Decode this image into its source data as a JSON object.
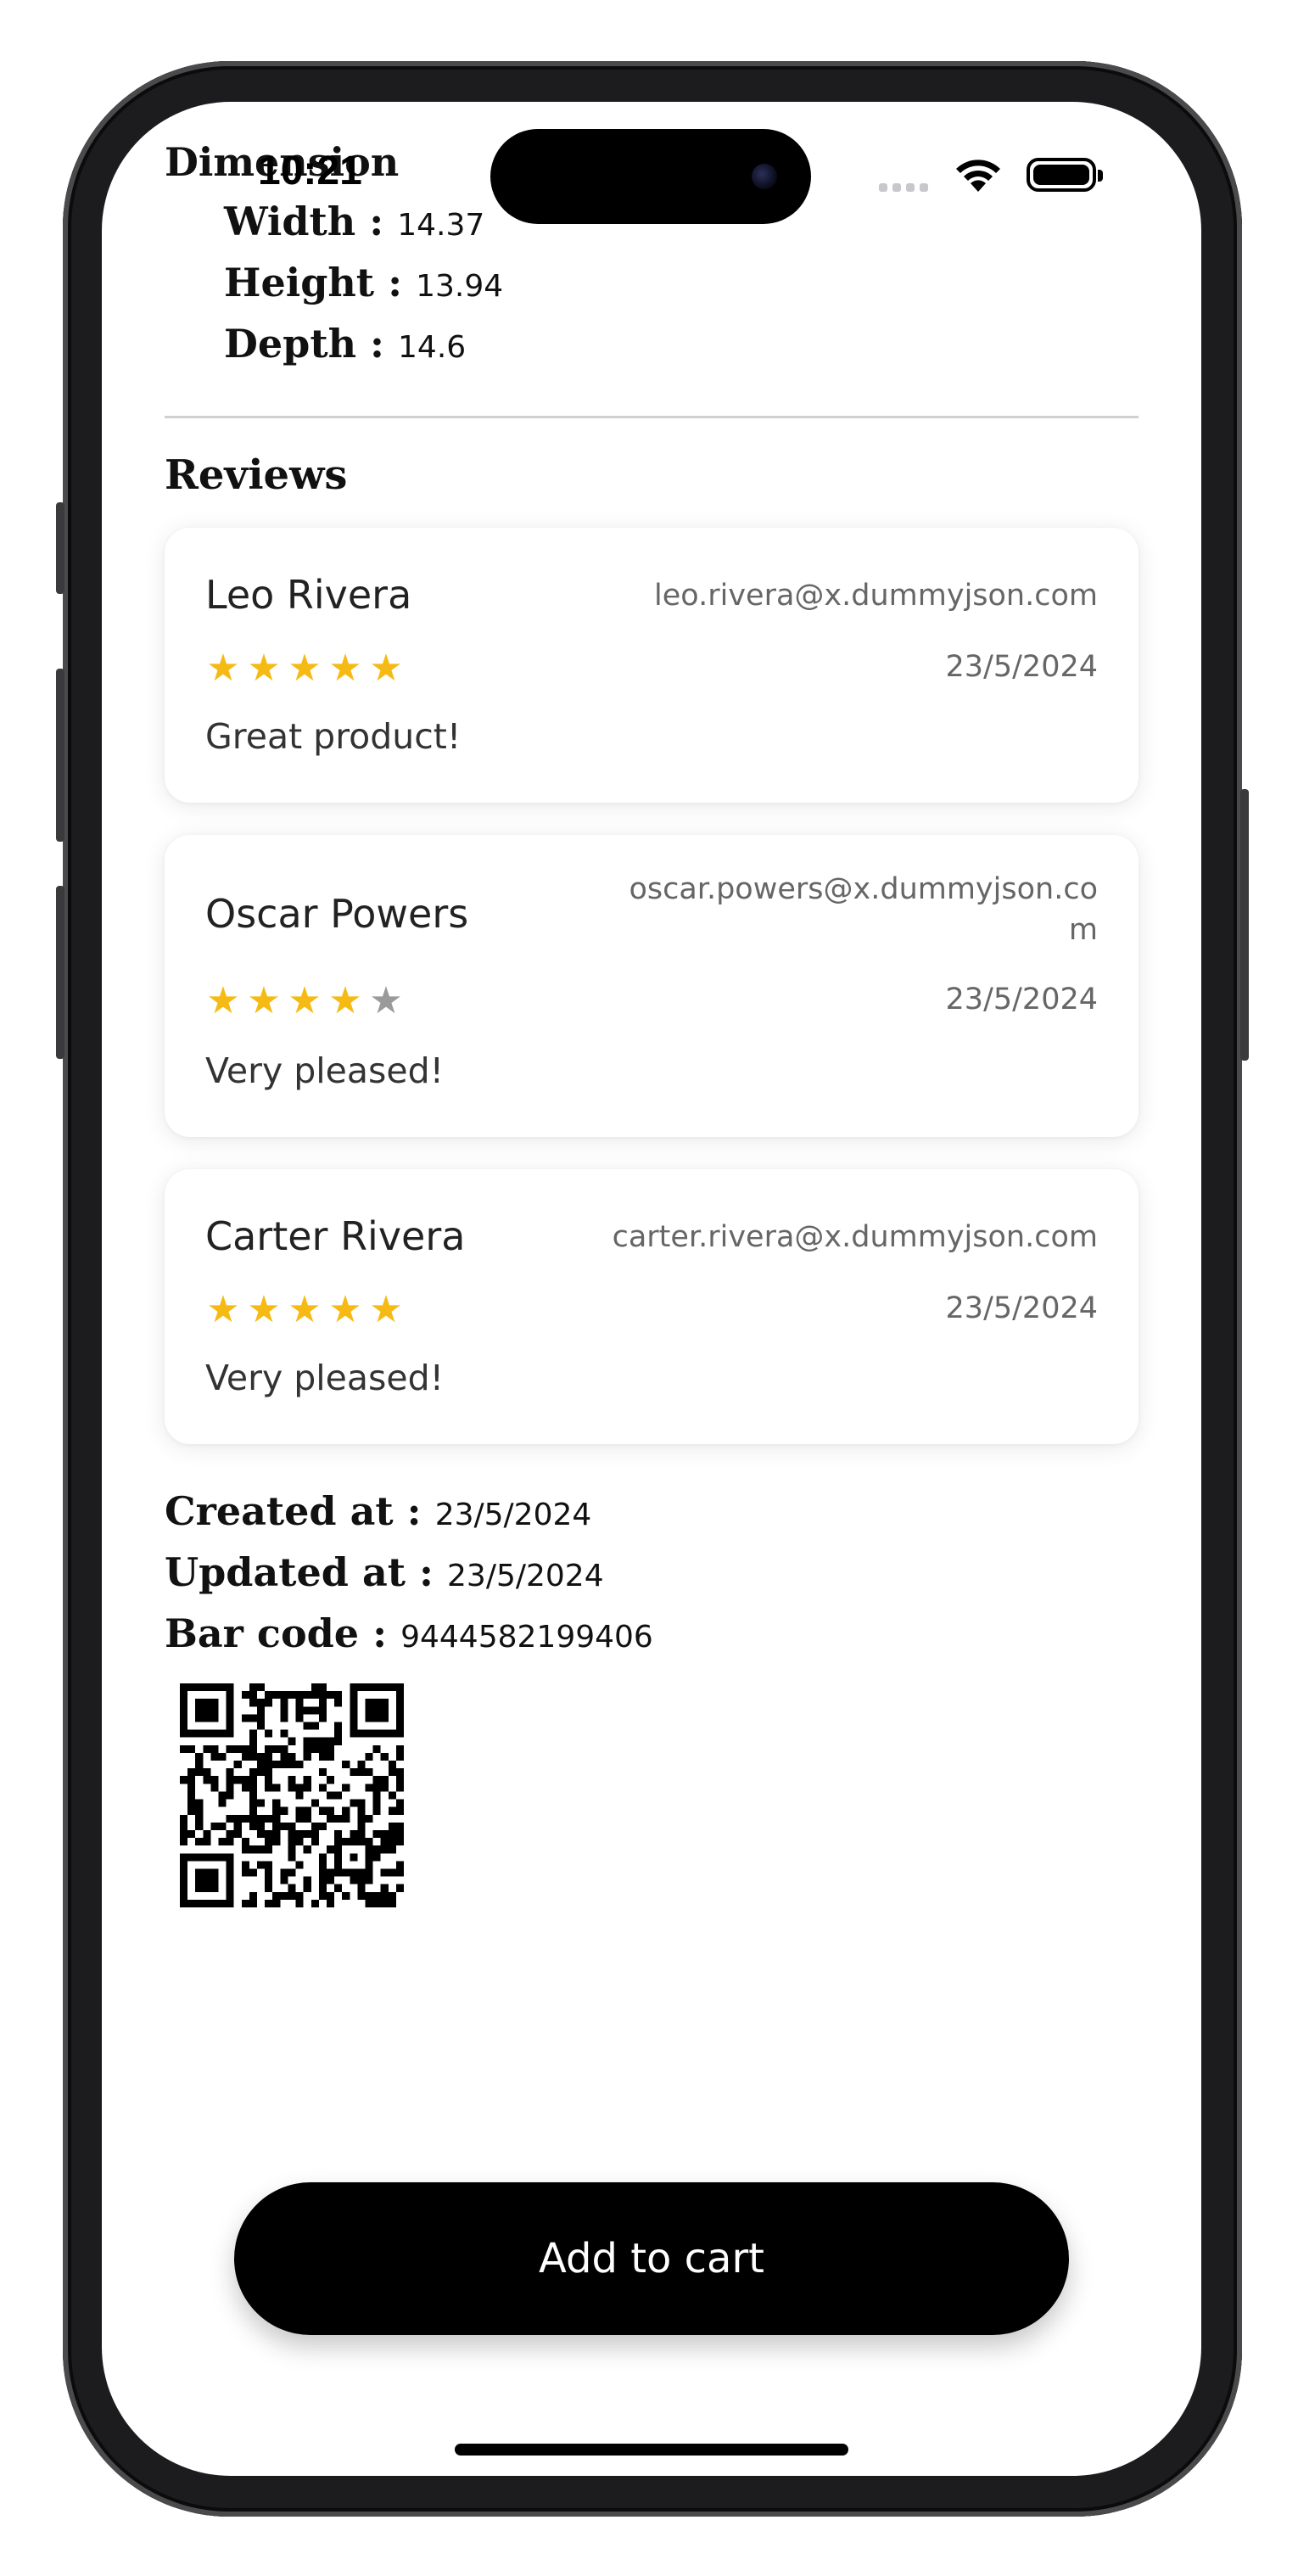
{
  "status_bar": {
    "time": "10:21",
    "icons": [
      "signal-icon",
      "wifi-icon",
      "battery-icon"
    ]
  },
  "dimensions": {
    "title": "Dimension",
    "width_label": "Width :",
    "width_value": "14.37",
    "height_label": "Height :",
    "height_value": "13.94",
    "depth_label": "Depth :",
    "depth_value": "14.6"
  },
  "reviews": {
    "title": "Reviews",
    "items": [
      {
        "name": "Leo Rivera",
        "email": "leo.rivera@x.dummyjson.com",
        "rating": 5,
        "date": "23/5/2024",
        "comment": "Great product!"
      },
      {
        "name": "Oscar Powers",
        "email_line1": "oscar.powers@x.dummyjson.co",
        "email_line2": "m",
        "rating": 4,
        "date": "23/5/2024",
        "comment": "Very pleased!"
      },
      {
        "name": "Carter Rivera",
        "email": "carter.rivera@x.dummyjson.com",
        "rating": 5,
        "date": "23/5/2024",
        "comment": "Very pleased!"
      }
    ]
  },
  "meta": {
    "created_label": "Created at :",
    "created_value": "23/5/2024",
    "updated_label": "Updated at :",
    "updated_value": "23/5/2024",
    "barcode_label": "Bar code :",
    "barcode_value": "9444582199406"
  },
  "actions": {
    "add_to_cart_label": "Add to cart"
  },
  "colors": {
    "star_filled": "#f5bb14",
    "star_empty": "#9a9a9a",
    "button_bg": "#000000"
  }
}
